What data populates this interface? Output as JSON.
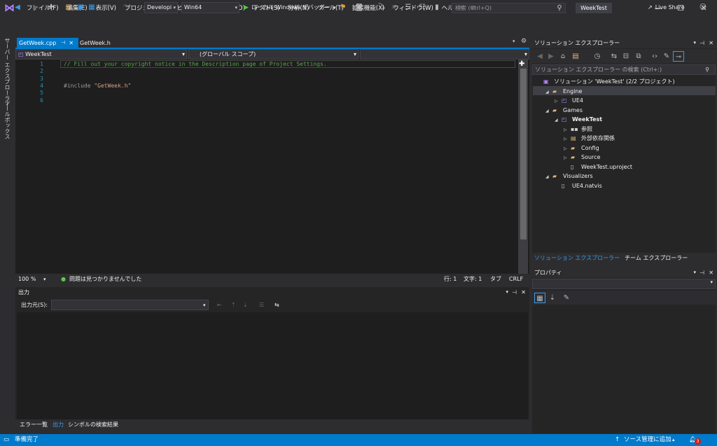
{
  "window": {
    "title": "WeekTest",
    "search_placeholder": "検索 (Ctrl+Q)"
  },
  "menu": [
    "ファイル(F)",
    "編集(E)",
    "表示(V)",
    "プロジェクト(P)",
    "ビルド(B)",
    "デバッグ(D)",
    "テスト(S)",
    "分析(N)",
    "ツール(T)",
    "拡張機能(X)",
    "ウィンドウ(W)",
    "ヘルプ(H)"
  ],
  "toolbar": {
    "config": "Developi",
    "platform": "Win64",
    "run_label": "ローカル Windows デバッガー",
    "live_share": "Live Share"
  },
  "leftrail": {
    "server_explorer": "サーバー エクスプローラー",
    "toolbox": "ツールボックス"
  },
  "editor": {
    "tabs": [
      {
        "label": "GetWeek.cpp",
        "active": true
      },
      {
        "label": "GetWeek.h",
        "active": false
      }
    ],
    "nav_project": "WeekTest",
    "nav_scope": "(グローバル スコープ)",
    "lines": [
      {
        "num": "1",
        "text": "// Fill out your copyright notice in the Description page of Project Settings.",
        "kind": "comment"
      },
      {
        "num": "2",
        "text": "",
        "kind": "plain"
      },
      {
        "num": "3",
        "text": "",
        "kind": "plain"
      },
      {
        "num": "4",
        "text": "#include \"GetWeek.h\"",
        "kind": "include"
      },
      {
        "num": "5",
        "text": "",
        "kind": "plain"
      },
      {
        "num": "6",
        "text": "",
        "kind": "plain"
      }
    ],
    "zoom": "100 %",
    "issues": "問題は見つかりませんでした",
    "line_pos": "行: 1",
    "col_pos": "文字: 1",
    "tab_mode": "タブ",
    "eol": "CRLF"
  },
  "output": {
    "title": "出力",
    "source_label": "出力元(S):",
    "bottom_tabs": [
      "エラー一覧",
      "出力",
      "シンボルの検索結果"
    ]
  },
  "solution_explorer": {
    "title": "ソリューション エクスプローラー",
    "search_placeholder": "ソリューション エクスプローラー の検索 (Ctrl+:)",
    "tree": [
      {
        "label": "ソリューション 'WeekTest' (2/2 プロジェクト)",
        "depth": 0,
        "arrow": "",
        "icon": "solution-icon",
        "bold": false
      },
      {
        "label": "Engine",
        "depth": 1,
        "arrow": "expanded",
        "icon": "folder-icon",
        "bold": false
      },
      {
        "label": "UE4",
        "depth": 2,
        "arrow": "collapsed",
        "icon": "project-icon",
        "bold": false
      },
      {
        "label": "Games",
        "depth": 1,
        "arrow": "expanded",
        "icon": "folder-icon",
        "bold": false
      },
      {
        "label": "WeekTest",
        "depth": 2,
        "arrow": "expanded",
        "icon": "project-icon",
        "bold": true
      },
      {
        "label": "参照",
        "depth": 3,
        "arrow": "collapsed",
        "icon": "references-icon",
        "bold": false
      },
      {
        "label": "外部依存関係",
        "depth": 3,
        "arrow": "collapsed",
        "icon": "external-deps-icon",
        "bold": false
      },
      {
        "label": "Config",
        "depth": 3,
        "arrow": "collapsed",
        "icon": "folder-icon",
        "bold": false
      },
      {
        "label": "Source",
        "depth": 3,
        "arrow": "collapsed",
        "icon": "folder-icon",
        "bold": false
      },
      {
        "label": "WeekTest.uproject",
        "depth": 3,
        "arrow": "",
        "icon": "file-icon",
        "bold": false
      },
      {
        "label": "Visualizers",
        "depth": 1,
        "arrow": "expanded",
        "icon": "folder-icon",
        "bold": false
      },
      {
        "label": "UE4.natvis",
        "depth": 2,
        "arrow": "",
        "icon": "file-icon",
        "bold": false
      }
    ],
    "tabs": [
      "ソリューション エクスプローラー",
      "チーム エクスプローラー"
    ]
  },
  "properties": {
    "title": "プロパティ"
  },
  "statusbar": {
    "ready": "準備完了",
    "source_control": "ソース管理に追加",
    "notifications": "3"
  },
  "colors": {
    "accent": "#007acc",
    "comment": "#57a64a",
    "include": "#9b9b9b",
    "string": "#d69d85",
    "line_number": "#2b91af"
  }
}
